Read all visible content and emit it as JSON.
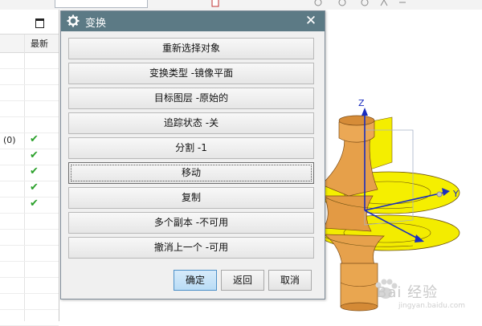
{
  "top_search": {
    "placeholder": ""
  },
  "navigator": {
    "column_header": "最新",
    "rows": [
      {
        "text": "",
        "check": ""
      },
      {
        "text": "",
        "check": ""
      },
      {
        "text": "",
        "check": ""
      },
      {
        "text": "",
        "check": ""
      },
      {
        "text": "",
        "check": ""
      },
      {
        "text": "(0)",
        "check": "✔"
      },
      {
        "text": "",
        "check": "✔"
      },
      {
        "text": "",
        "check": "✔"
      },
      {
        "text": "",
        "check": "✔"
      },
      {
        "text": "",
        "check": "✔"
      },
      {
        "text": "",
        "check": ""
      },
      {
        "text": "",
        "check": ""
      },
      {
        "text": "",
        "check": ""
      },
      {
        "text": "",
        "check": ""
      },
      {
        "text": "",
        "check": ""
      },
      {
        "text": "",
        "check": ""
      },
      {
        "text": "",
        "check": ""
      }
    ]
  },
  "dialog": {
    "title": "变换",
    "close_glyph": "✕",
    "options": [
      "重新选择对象",
      "变换类型 -镜像平面",
      "目标图层 -原始的",
      "追踪状态 -关",
      "分割 -1",
      "移动",
      "复制",
      "多个副本 -不可用",
      "撤消上一个 -可用"
    ],
    "ok_label": "确定",
    "back_label": "返回",
    "cancel_label": "取消"
  },
  "viewport": {
    "axis_z": "Z",
    "axis_y": "Y",
    "colors": {
      "part_orange": "#e8a550",
      "part_yellow": "#f7f000",
      "axis_blue": "#1a2dbf"
    }
  },
  "watermark": {
    "text": "Bai 经验",
    "sub": "jingyan.baidu.com"
  }
}
